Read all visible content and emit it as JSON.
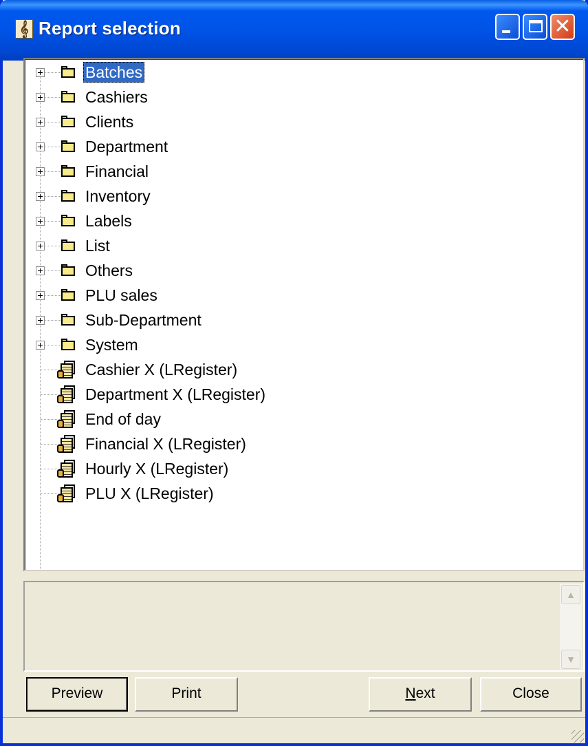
{
  "window": {
    "title": "Report selection"
  },
  "titlebar_buttons": {
    "minimize_icon": "minimize-icon",
    "maximize_icon": "maximize-icon",
    "close_glyph": "✕"
  },
  "tree": {
    "folders": [
      {
        "label": "Batches",
        "selected": true
      },
      {
        "label": "Cashiers"
      },
      {
        "label": "Clients"
      },
      {
        "label": "Department"
      },
      {
        "label": "Financial"
      },
      {
        "label": "Inventory"
      },
      {
        "label": "Labels"
      },
      {
        "label": "List"
      },
      {
        "label": "Others"
      },
      {
        "label": "PLU sales"
      },
      {
        "label": "Sub-Department"
      },
      {
        "label": "System"
      }
    ],
    "reports": [
      {
        "label": "Cashier X (LRegister)"
      },
      {
        "label": "Department X (LRegister)"
      },
      {
        "label": "End of day"
      },
      {
        "label": "Financial X (LRegister)"
      },
      {
        "label": "Hourly X (LRegister)"
      },
      {
        "label": "PLU X (LRegister)"
      }
    ]
  },
  "description": {
    "text": ""
  },
  "buttons": {
    "preview": "Preview",
    "print": "Print",
    "next": "Next",
    "close": "Close"
  },
  "colors": {
    "titlebar": "#0054e3",
    "selection": "#316ac5",
    "face": "#ece9d8"
  }
}
